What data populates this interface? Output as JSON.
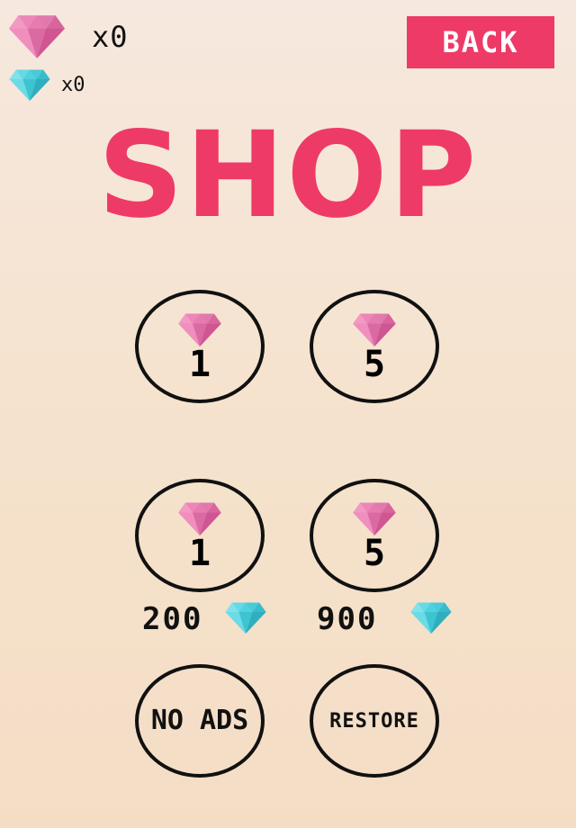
{
  "hud": {
    "pink_count": "x0",
    "blue_count": "x0"
  },
  "back_label": "BACK",
  "title": "SHOP",
  "packs": [
    {
      "quantity": "1",
      "gem": "pink-diamond-icon"
    },
    {
      "quantity": "5",
      "gem": "pink-diamond-icon"
    },
    {
      "quantity": "1",
      "gem": "pink-diamond-icon",
      "price": "200",
      "currency": "blue-diamond-icon"
    },
    {
      "quantity": "5",
      "gem": "pink-diamond-icon",
      "price": "900",
      "currency": "blue-diamond-icon"
    }
  ],
  "no_ads_label": "NO ADS",
  "restore_label": "RESTORE",
  "colors": {
    "accent": "#ee3a67",
    "pink_gem": "#e77bb0",
    "blue_gem": "#4fd1de",
    "outline": "#111111"
  }
}
